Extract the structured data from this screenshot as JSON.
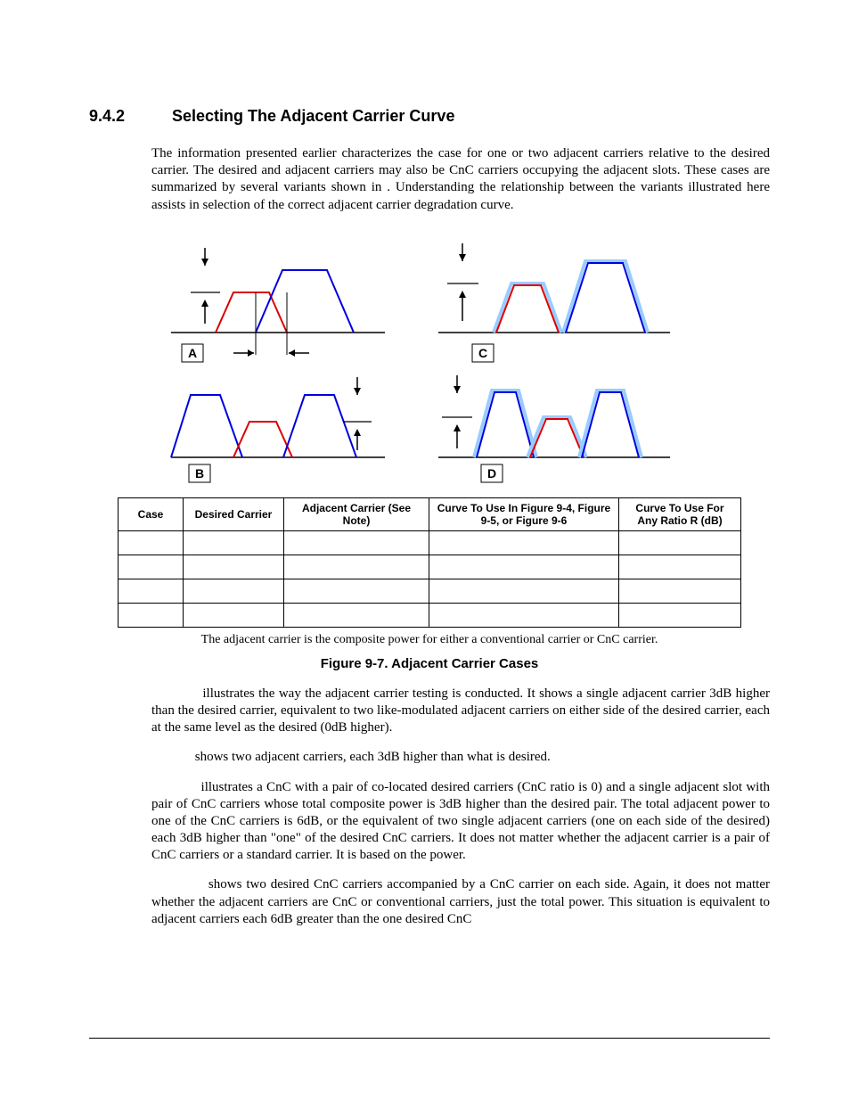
{
  "section": {
    "number": "9.4.2",
    "title": "Selecting The Adjacent Carrier Curve"
  },
  "intro_paragraph": "The information presented earlier characterizes the case for one or two adjacent carriers relative to the desired carrier. The desired and adjacent carriers may also be CnC carriers occupying the adjacent slots. These cases are summarized by several variants shown in                 . Understanding the relationship between the variants illustrated here assists in selection of the correct adjacent carrier degradation curve.",
  "diagram_labels": {
    "A": "A",
    "B": "B",
    "C": "C",
    "D": "D"
  },
  "table": {
    "headers": {
      "case": "Case",
      "desired": "Desired Carrier",
      "adjacent": "Adjacent Carrier (See Note)",
      "curve_fig": "Curve To Use In Figure 9-4, Figure 9-5, or Figure 9-6",
      "curve_ratio": "Curve To Use For Any Ratio R (dB)"
    },
    "rows": [
      {
        "case": "",
        "desired": "",
        "adjacent": "",
        "curve_fig": "",
        "curve_ratio": ""
      },
      {
        "case": "",
        "desired": "",
        "adjacent": "",
        "curve_fig": "",
        "curve_ratio": ""
      },
      {
        "case": "",
        "desired": "",
        "adjacent": "",
        "curve_fig": "",
        "curve_ratio": ""
      },
      {
        "case": "",
        "desired": "",
        "adjacent": "",
        "curve_fig": "",
        "curve_ratio": ""
      }
    ],
    "note": "The adjacent carrier is the composite power for either a conventional carrier or CnC carrier."
  },
  "figure_caption": "Figure 9-7. Adjacent Carrier Cases",
  "para_A": " illustrates the way the adjacent carrier testing is conducted. It shows a single adjacent carrier 3dB higher than the desired carrier, equivalent to two like-modulated adjacent carriers on either side of the desired carrier, each at the same level as the desired (0dB higher).",
  "para_B": " shows two adjacent carriers, each 3dB higher than what is desired.",
  "para_C": " illustrates a CnC with a pair of co-located desired carriers (CnC ratio is 0) and a single adjacent slot with pair of CnC carriers whose total composite power is 3dB higher than the desired pair. The total adjacent power to one of the CnC carriers is 6dB, or the equivalent of two single adjacent carriers (one on each side of the desired) each 3dB higher than \"one\" of the desired CnC carriers. It does not matter whether the adjacent carrier is a pair of CnC carriers or a standard carrier. It is based on the power.",
  "para_D": " shows two desired CnC carriers accompanied by a CnC carrier on each side. Again, it does not matter whether the adjacent carriers are CnC or conventional carriers, just the total power. This situation is equivalent to adjacent carriers each 6dB greater than the one desired CnC"
}
